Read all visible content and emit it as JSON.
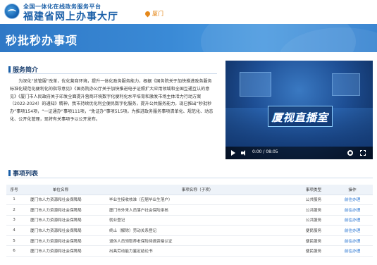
{
  "header": {
    "subtitle": "全国一体化在线政务服务平台",
    "title": "福建省网上办事大厅",
    "location": "厦门"
  },
  "banner": {
    "title": "秒批秒办事项"
  },
  "intro_section": {
    "heading": "服务简介",
    "text": "为深化“放管服”改革，优化营商环境，提升一体化政务服务能力，根据《国务院关于加快推进政务服务标准化规范化便利化的指导意见》《国务院办公厅关于加快推进电子证照扩大应用领域和全国互通互认的意见》《厦门市人民政府关于印发全面提升营商环境数字化便利化水平培育和激发市场主体活力行动方案（2022-2024）的通知》精神，我市持续优化利企便民数字化服务，提升公共服务能力，现已推出“秒批秒办”事项154项，“一证通办”事项111项，“免证办”事项515项。为推进政务服务事项清单化、规范化、动态化、公开化管理，现将有关事项予以公开发布。"
  },
  "video": {
    "overlay_title": "厦视直播室",
    "time": "0:00 / 08:05"
  },
  "list_section": {
    "heading": "事项列表",
    "columns": [
      "序号",
      "单位名称",
      "事项名称（子项）",
      "事项类型",
      "操作"
    ],
    "rows": [
      [
        "1",
        "厦门市人力资源和社会保障局",
        "毕业生接收核准（应届毕业生落户）",
        "公共服务",
        "前往办理"
      ],
      [
        "2",
        "厦门市人力资源和社会保障局",
        "厦门市外来人员落户社会保险审核",
        "公共服务",
        "前往办理"
      ],
      [
        "3",
        "厦门市人力资源和社会保障局",
        "就业登记",
        "公共服务",
        "前往办理"
      ],
      [
        "4",
        "厦门市人力资源和社会保障局",
        "终止（解除）劳动关系登记",
        "便民服务",
        "前往办理"
      ],
      [
        "5",
        "厦门市人力资源和社会保障局",
        "退休人员领取养老保险待遇资格认证",
        "便民服务",
        "前往办理"
      ],
      [
        "6",
        "厦门市人力资源和社会保障局",
        "出具劳动能力鉴定结论书",
        "便民服务",
        "前往办理"
      ]
    ]
  },
  "colors": {
    "brand": "#1a5fa8",
    "banner": "#3a8ad6",
    "link": "#1f6fd0",
    "location": "#e5881b"
  },
  "icons": [
    "logo-emblem",
    "location-pin-icon",
    "play-icon",
    "volume-icon",
    "settings-icon",
    "fullscreen-icon"
  ]
}
